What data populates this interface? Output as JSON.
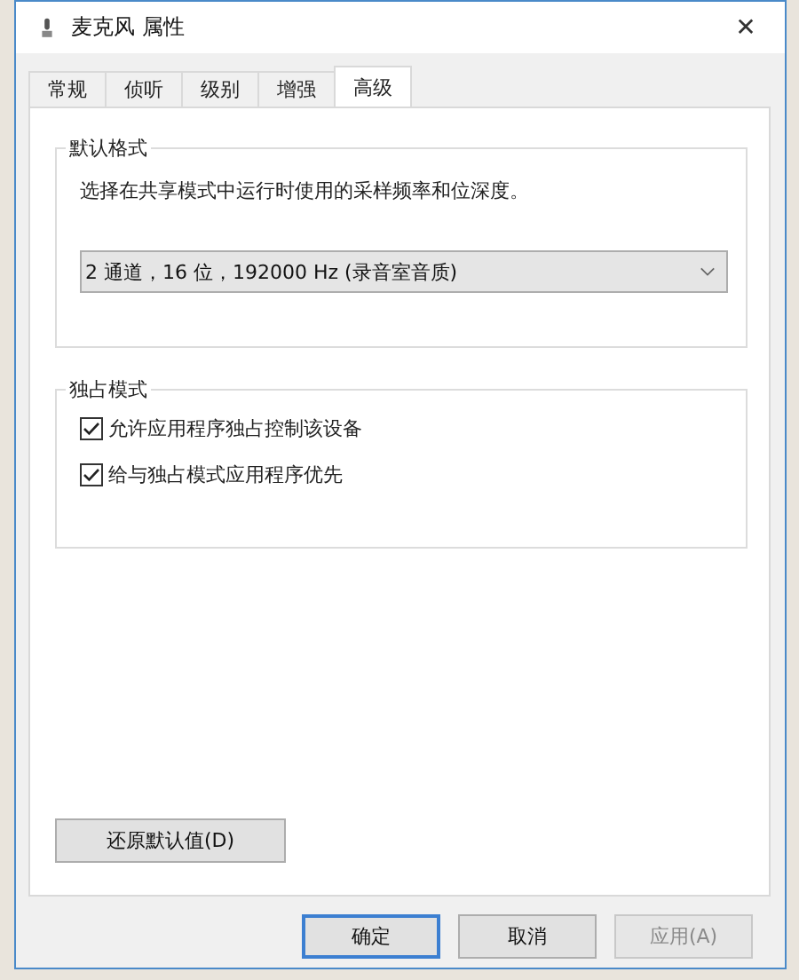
{
  "window": {
    "title": "麦克风 属性",
    "close": "✕"
  },
  "tabs": [
    {
      "label": "常规",
      "selected": false
    },
    {
      "label": "侦听",
      "selected": false
    },
    {
      "label": "级别",
      "selected": false
    },
    {
      "label": "增强",
      "selected": false
    },
    {
      "label": "高级",
      "selected": true
    }
  ],
  "default_format": {
    "legend": "默认格式",
    "description": "选择在共享模式中运行时使用的采样频率和位深度。",
    "dropdown": {
      "value": "2 通道，16 位，192000 Hz (录音室音质)"
    }
  },
  "exclusive_mode": {
    "legend": "独占模式",
    "options": [
      {
        "label": "允许应用程序独占控制该设备",
        "checked": true
      },
      {
        "label": "给与独占模式应用程序优先",
        "checked": true
      }
    ]
  },
  "restore_button": "还原默认值(D)",
  "buttons": [
    {
      "label": "确定",
      "default": true,
      "disabled": false
    },
    {
      "label": "取消",
      "default": false,
      "disabled": false
    },
    {
      "label": "应用(A)",
      "default": false,
      "disabled": true
    }
  ]
}
